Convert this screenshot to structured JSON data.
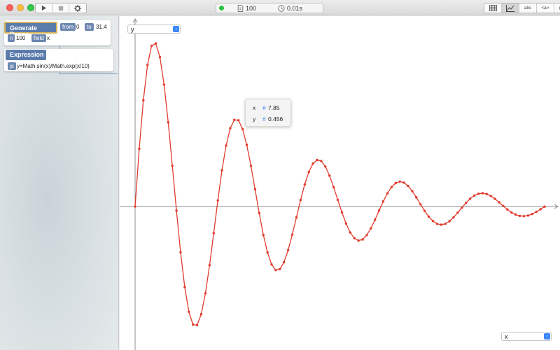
{
  "window": {
    "toolbar_left": [
      {
        "icon": "play-icon"
      },
      {
        "icon": "stop-icon"
      },
      {
        "icon": "gear-icon"
      }
    ],
    "status": {
      "indicator_color": "#2bc13f",
      "count": "100",
      "time": "0.01s"
    },
    "toolbar_right": [
      {
        "icon": "table-icon"
      },
      {
        "icon": "line-chart-icon",
        "active": true
      },
      {
        "label": "abc"
      },
      {
        "label": "<a>"
      },
      {
        "icon": "globe-icon"
      }
    ]
  },
  "pipeline": {
    "generate_range": {
      "title": "Generate Range",
      "from_label": "from",
      "from_value": "0",
      "to_label": "to",
      "to_value": "31.4",
      "n_label": "n",
      "n_value": "100",
      "field_label": "field",
      "field_value": "x"
    },
    "expression": {
      "title": "Expression",
      "lang_label": "js",
      "code": "y=Math.sin(x)/Math.exp(x/10)"
    }
  },
  "plot": {
    "y_select": "y",
    "x_select": "x",
    "line_color": "#e03b2e",
    "tooltip": {
      "x_label": "x",
      "x_value": "7.85",
      "y_label": "y",
      "y_value": "0.456"
    }
  },
  "chart_data": {
    "type": "line",
    "function": "y = sin(x) / exp(x/10)",
    "x_start": 0,
    "x_end": 31.4,
    "n_points": 100,
    "series": [
      {
        "name": "y"
      }
    ],
    "xlabel": "x",
    "ylabel": "y",
    "grid": false,
    "xlim": [
      0,
      31.4
    ],
    "ylim": [
      -0.75,
      1.0
    ]
  }
}
